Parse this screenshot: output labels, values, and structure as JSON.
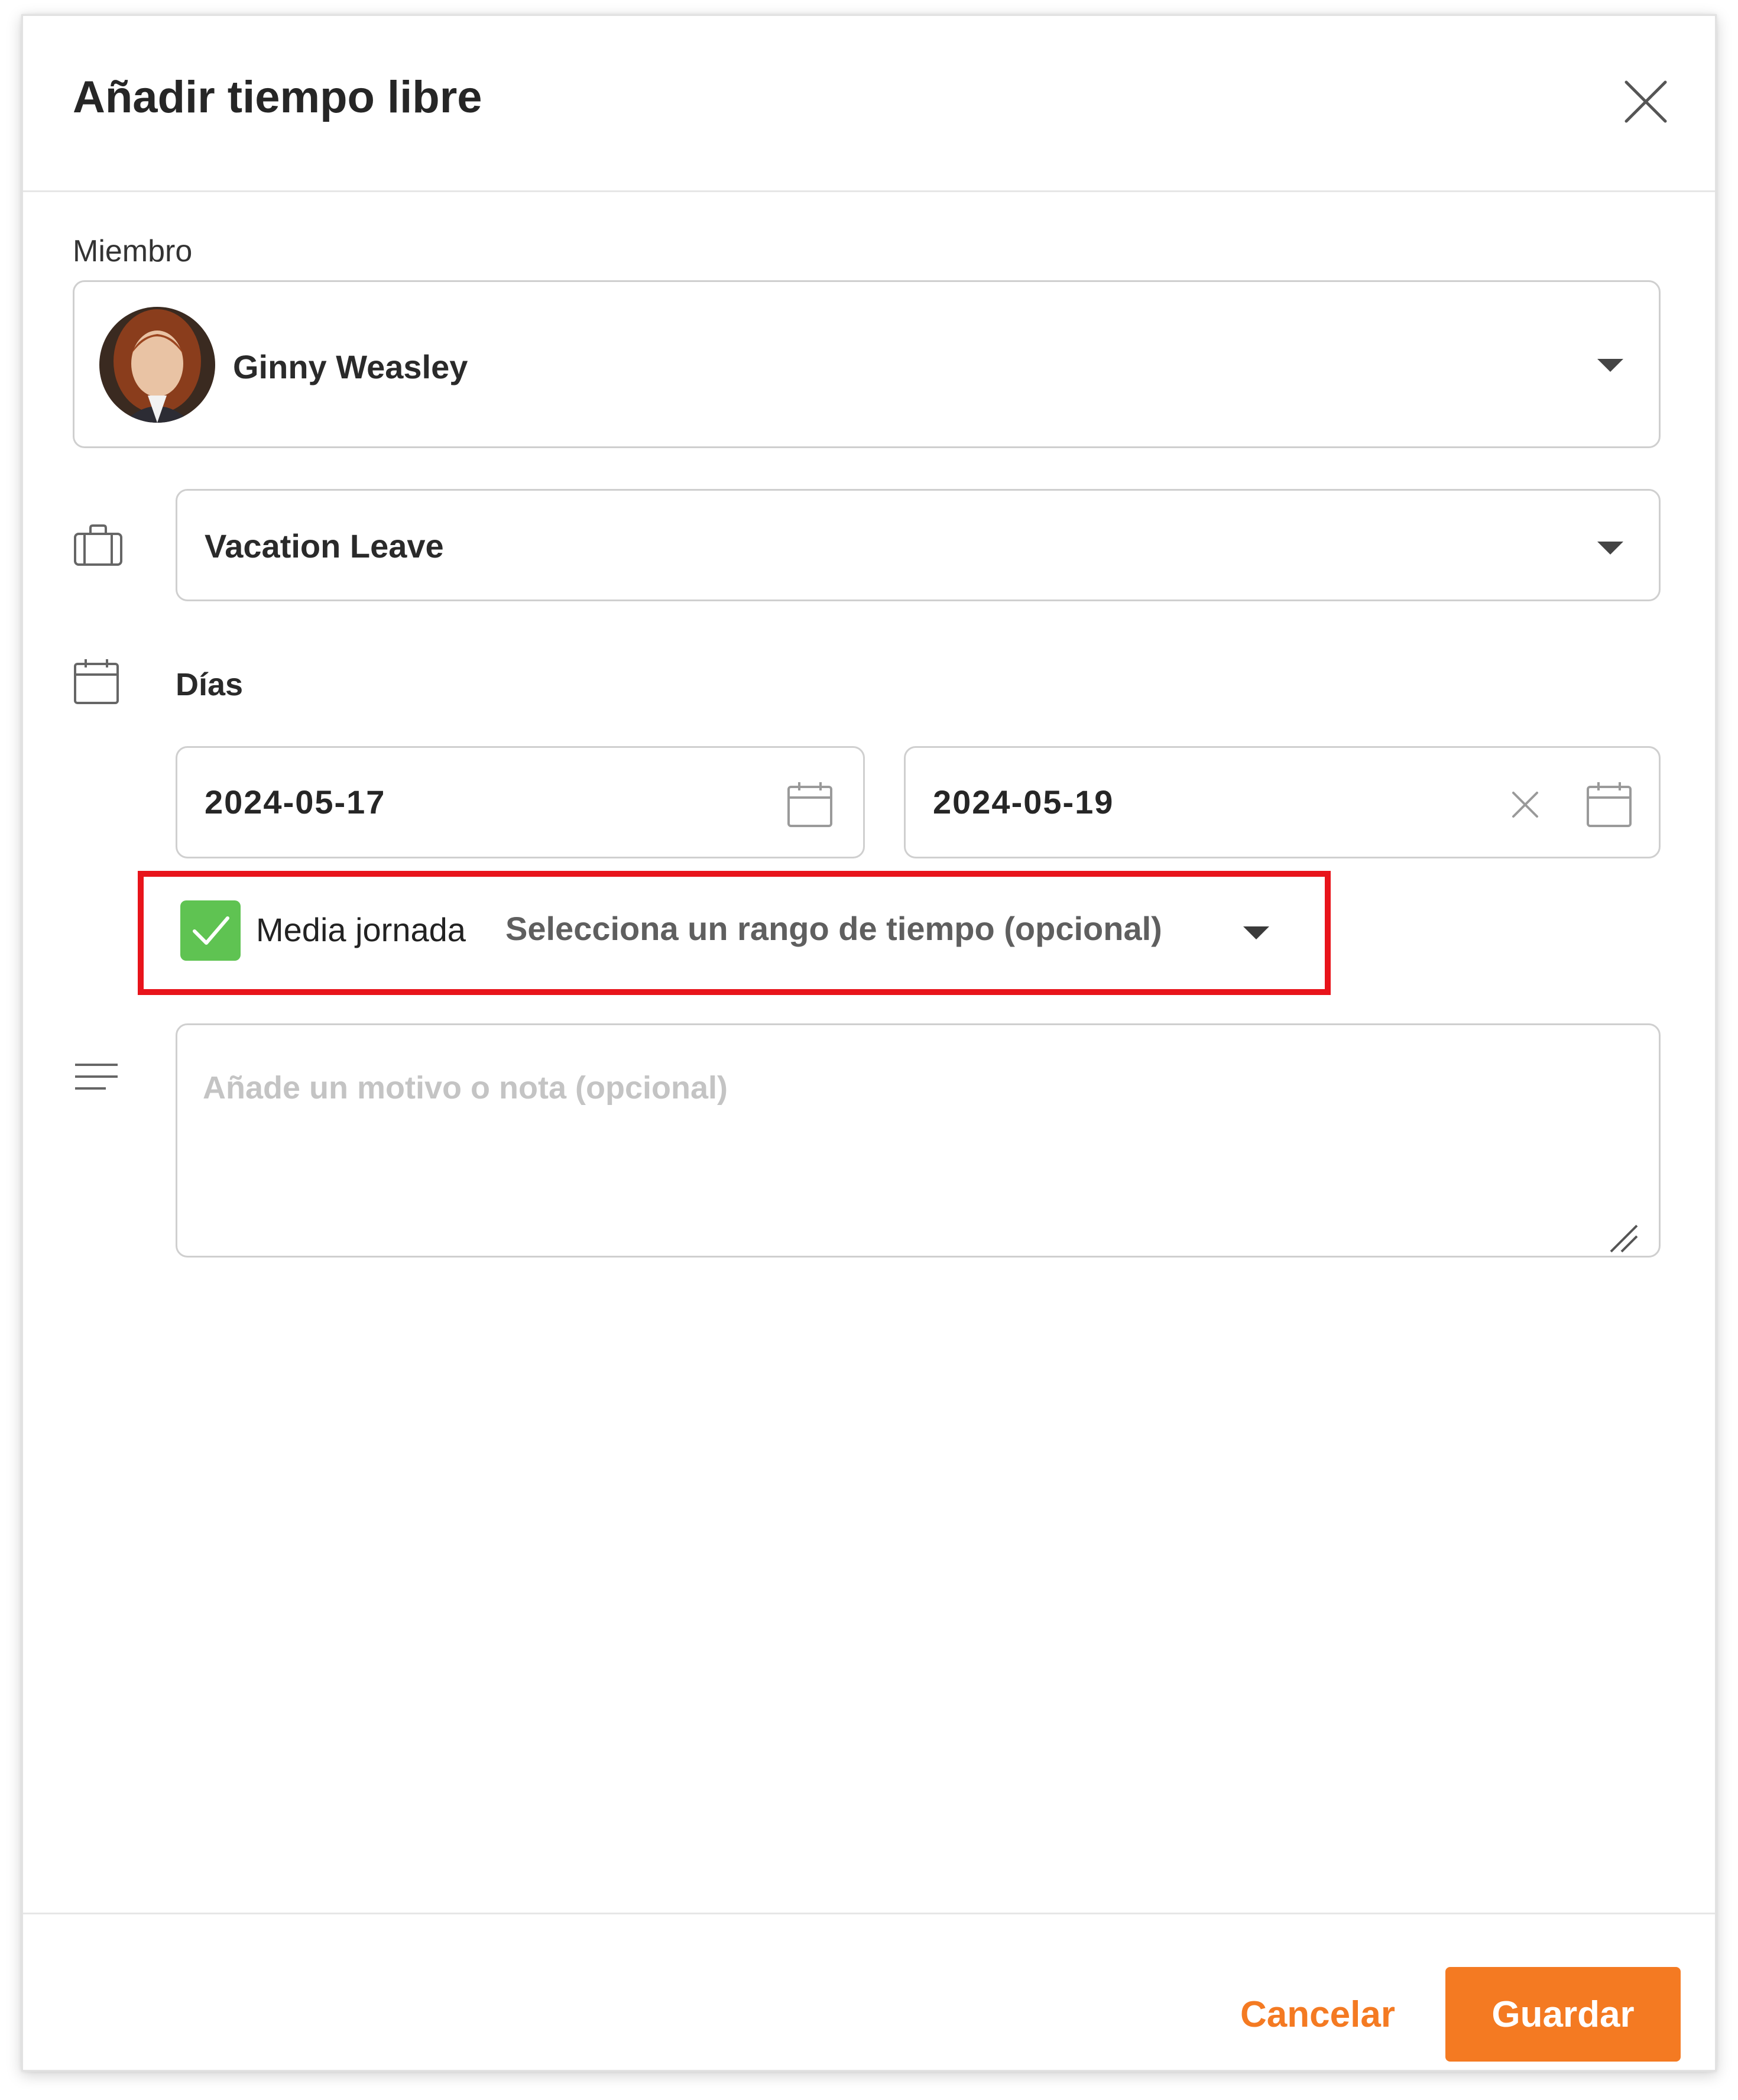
{
  "dialog": {
    "title": "Añadir tiempo libre"
  },
  "member": {
    "label": "Miembro",
    "name": "Ginny Weasley"
  },
  "leave_type": {
    "value": "Vacation Leave"
  },
  "days": {
    "label": "Días",
    "start_date": "2024-05-17",
    "end_date": "2024-05-19"
  },
  "half_day": {
    "checked": true,
    "label": "Media jornada",
    "range_placeholder": "Selecciona un rango de tiempo (opcional)"
  },
  "note": {
    "placeholder": "Añade un motivo o nota (opcional)"
  },
  "footer": {
    "cancel_label": "Cancelar",
    "save_label": "Guardar"
  },
  "colors": {
    "accent": "#f47a22",
    "checkbox": "#5fc352",
    "highlight": "#e8141b"
  },
  "icons": {
    "close": "close-icon",
    "leave": "briefcase-icon",
    "days": "calendar-icon",
    "note": "text-lines-icon",
    "date_picker": "calendar-icon",
    "clear": "clear-icon"
  }
}
